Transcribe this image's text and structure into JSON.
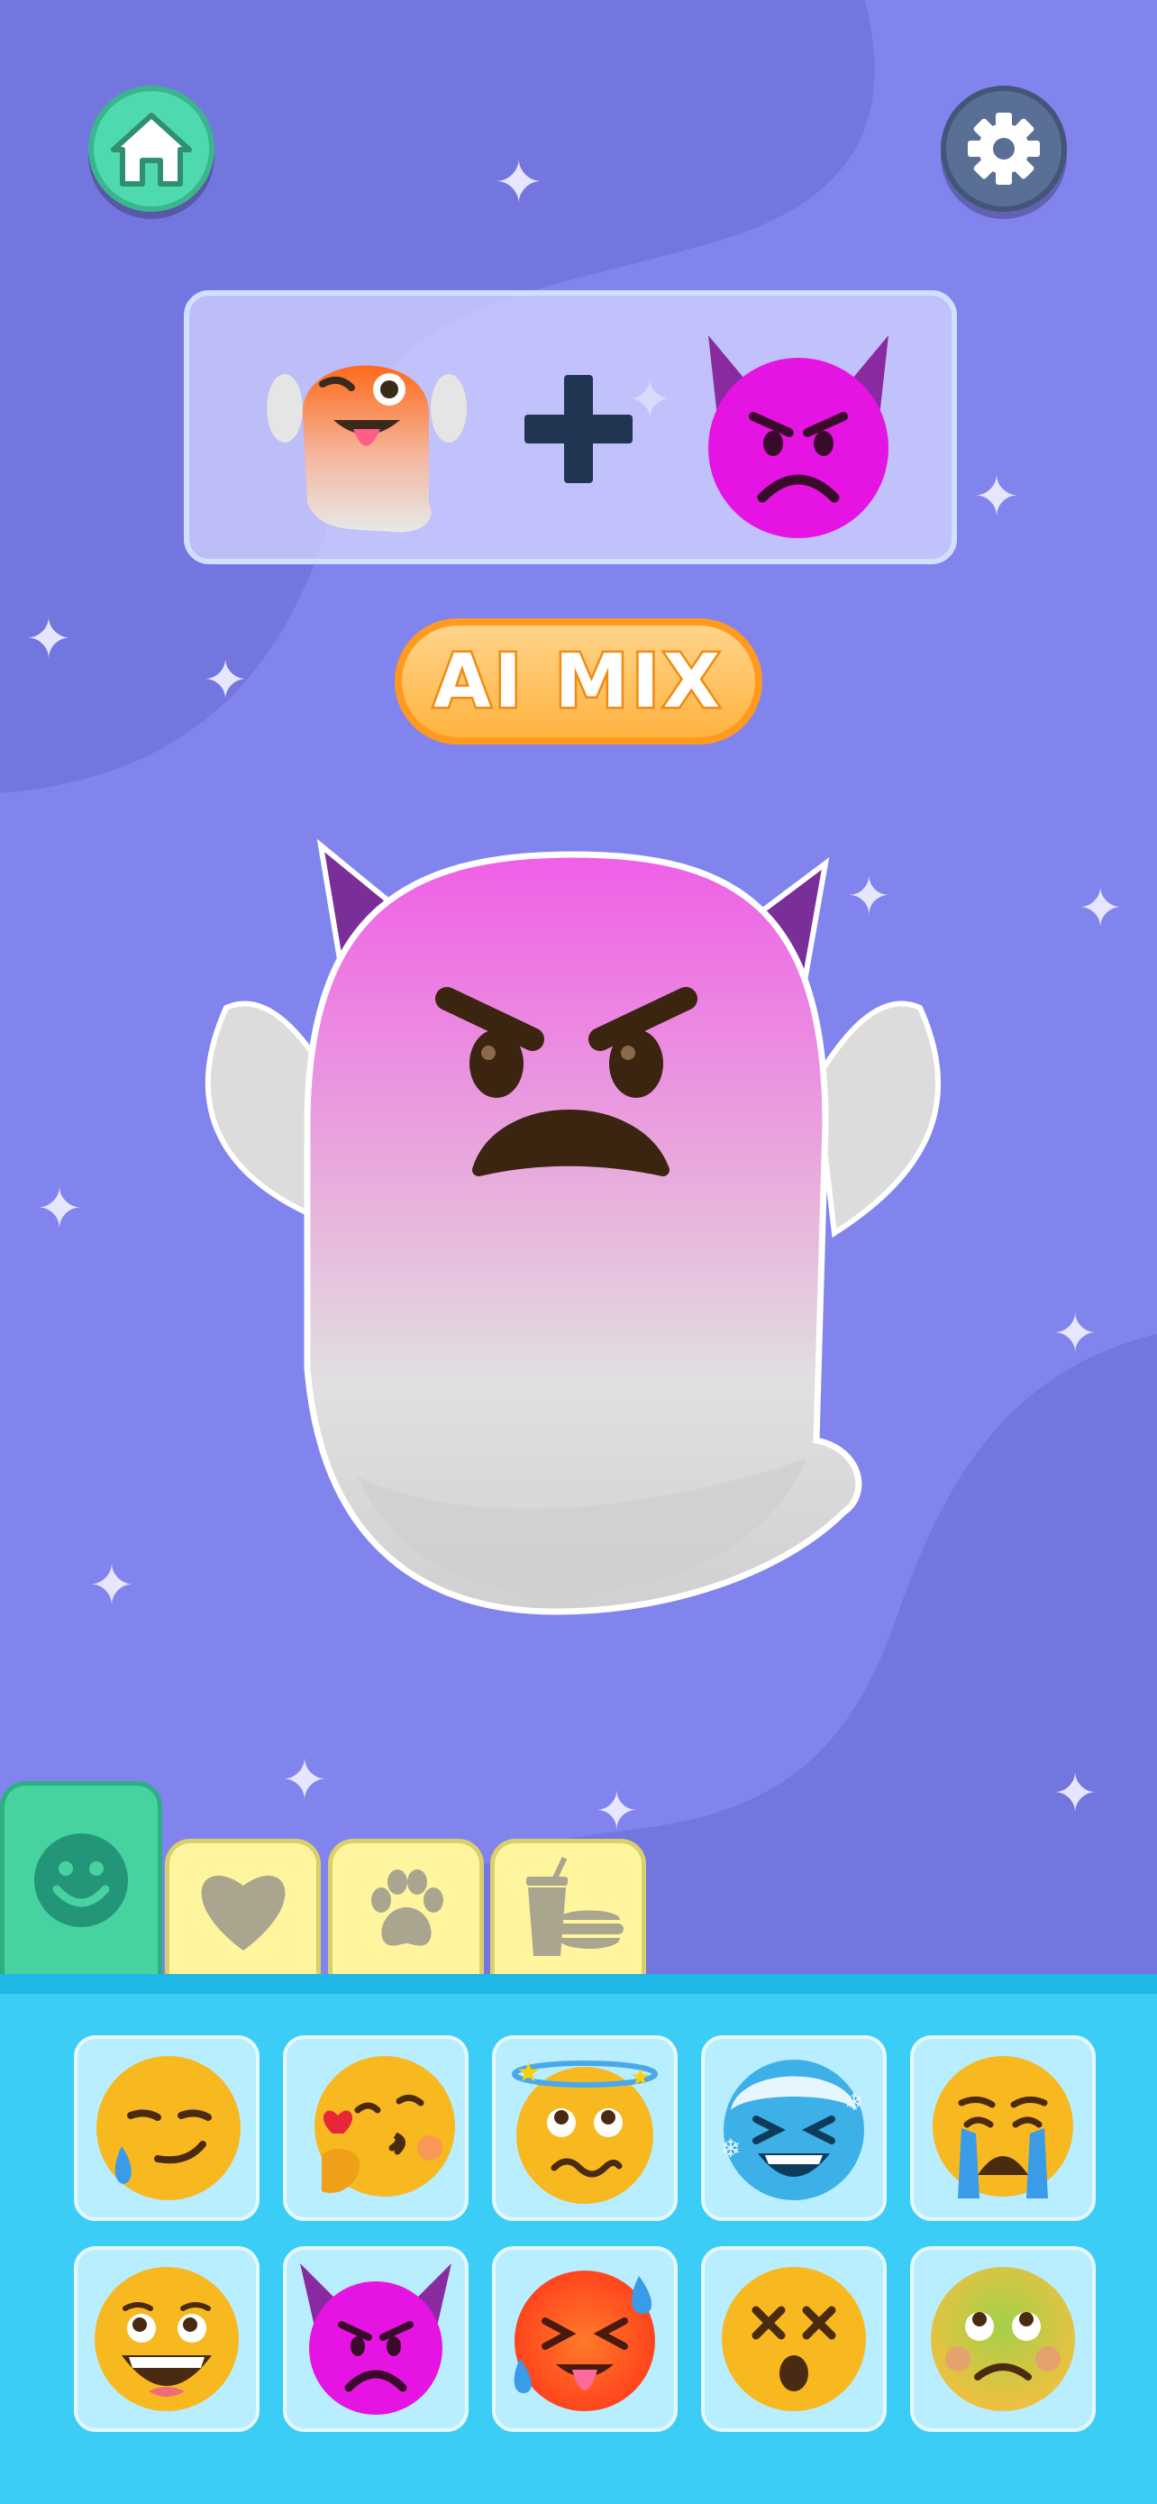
{
  "app": {
    "accent_color": "#ff9a1f",
    "background_color": "#8284ee"
  },
  "top_bar": {
    "home_icon": "home-icon",
    "settings_icon": "gear-icon"
  },
  "combination": {
    "left_emoji": "winking-ghost-emoji",
    "operator_icon": "plus-icon",
    "right_emoji": "angry-devil-emoji"
  },
  "mix_button": {
    "label": "AI MIX"
  },
  "result": {
    "emoji": "angry-devil-ghost-emoji"
  },
  "category_tabs": [
    {
      "icon": "smiley-icon",
      "selected": true
    },
    {
      "icon": "heart-icon",
      "selected": false
    },
    {
      "icon": "paw-icon",
      "selected": false
    },
    {
      "icon": "food-icon",
      "selected": false
    }
  ],
  "emoji_grid": [
    {
      "name": "smirk-tear-emoji"
    },
    {
      "name": "heart-kiss-emoji"
    },
    {
      "name": "dizzy-halo-emoji"
    },
    {
      "name": "frozen-laugh-emoji"
    },
    {
      "name": "crying-emoji"
    },
    {
      "name": "happy-tears-emoji"
    },
    {
      "name": "angry-devil-emoji"
    },
    {
      "name": "hot-sweat-tongue-emoji"
    },
    {
      "name": "dizzy-x-eyes-emoji"
    },
    {
      "name": "nauseated-emoji"
    }
  ]
}
